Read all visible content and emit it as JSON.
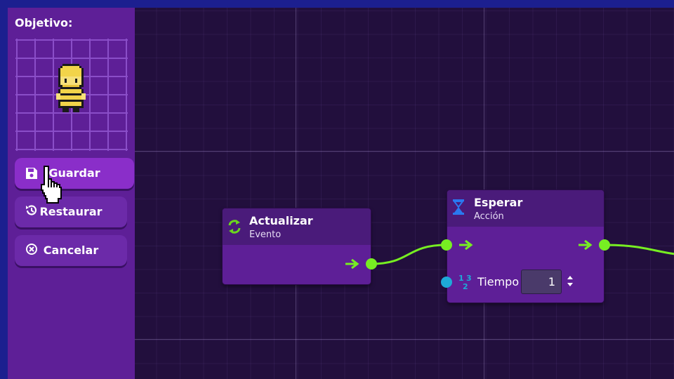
{
  "sidebar": {
    "title": "Objetivo:",
    "buttons": [
      {
        "label": "Guardar",
        "icon": "floppy-disk-icon"
      },
      {
        "label": "Restaurar",
        "icon": "history-icon"
      },
      {
        "label": "Cancelar",
        "icon": "close-circle-icon"
      }
    ]
  },
  "nodes": {
    "update": {
      "title": "Actualizar",
      "subtitle": "Evento",
      "icon": "refresh-icon"
    },
    "wait": {
      "title": "Esperar",
      "subtitle": "Acción",
      "icon": "hourglass-icon",
      "field_label": "Tiempo",
      "field_value": "1",
      "field_type_icon": "number-icon"
    }
  },
  "colors": {
    "wire": "#77ee22",
    "number_port": "#1eaad8",
    "sidebar": "#5e1f97",
    "node": "#5e1f97",
    "canvas": "#220f3d",
    "frame": "#1c1f8f"
  }
}
